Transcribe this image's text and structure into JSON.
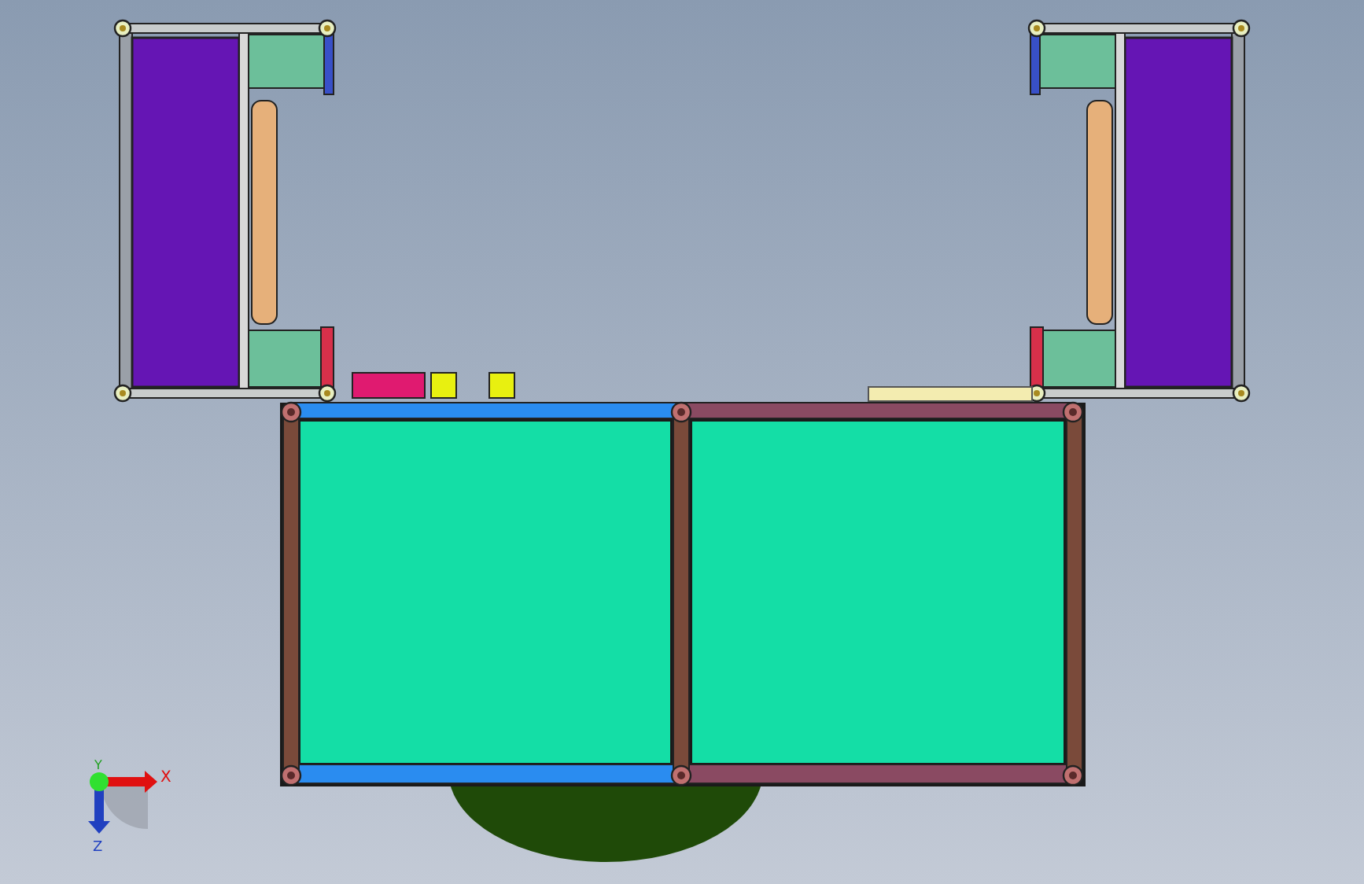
{
  "viewport": {
    "triad": {
      "x_label": "X",
      "y_label": "Y",
      "z_label": "Z"
    }
  }
}
